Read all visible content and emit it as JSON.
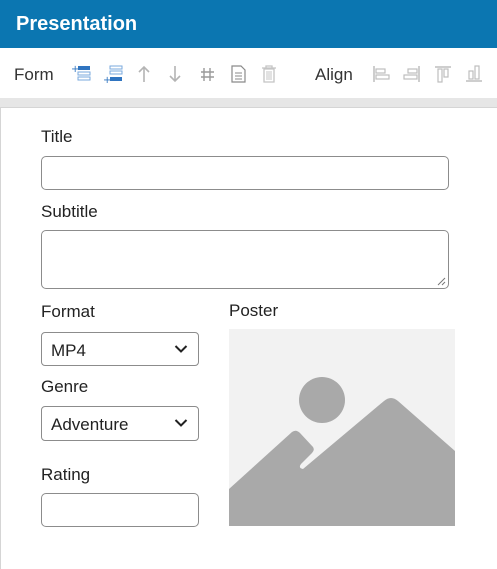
{
  "window": {
    "title": "Presentation"
  },
  "toolbar": {
    "form_label": "Form",
    "align_label": "Align",
    "form_buttons": [
      "insert-row-above-icon",
      "insert-row-below-icon",
      "move-up-icon",
      "move-down-icon",
      "grid-icon",
      "document-icon",
      "trash-icon"
    ],
    "align_buttons": [
      "align-left-icon",
      "align-right-icon",
      "align-top-icon",
      "align-bottom-icon"
    ]
  },
  "form": {
    "title_label": "Title",
    "title_value": "",
    "subtitle_label": "Subtitle",
    "subtitle_value": "",
    "format_label": "Format",
    "format_value": "MP4",
    "genre_label": "Genre",
    "genre_value": "Adventure",
    "rating_label": "Rating",
    "rating_value": "",
    "poster_label": "Poster",
    "poster_icon": "image-placeholder-icon"
  },
  "colors": {
    "titlebar": "#0b76b1",
    "toolbar_icon_blue": "#2f74c0",
    "toolbar_icon_gray": "#b4b4b4",
    "placeholder_gray": "#a9a9a9"
  }
}
